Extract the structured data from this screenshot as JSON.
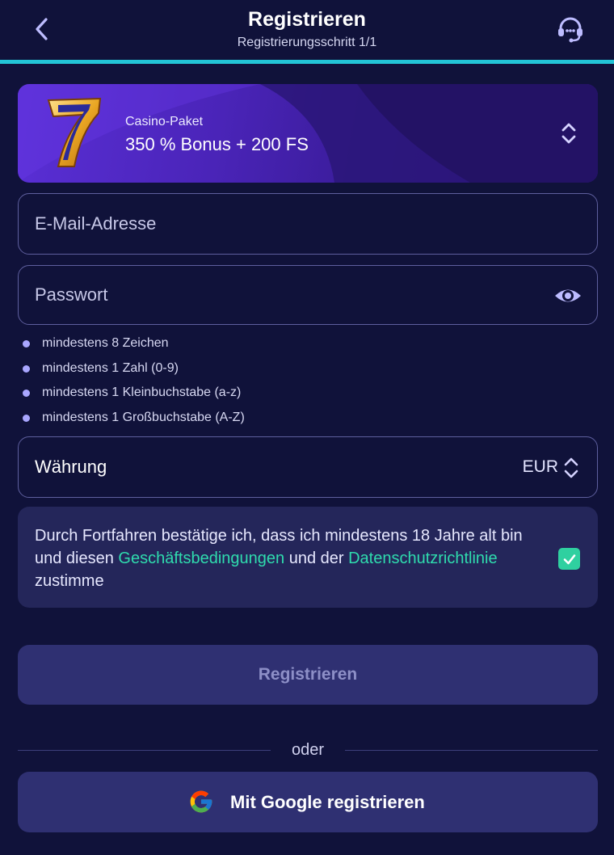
{
  "header": {
    "title": "Registrieren",
    "subtitle": "Registrierungsschritt 1/1",
    "progress_fraction": 1.0
  },
  "bonus": {
    "label": "Casino-Paket",
    "value": "350 % Bonus + 200 FS",
    "icon": "lucky-seven-icon"
  },
  "email": {
    "placeholder": "E-Mail-Adresse",
    "value": ""
  },
  "password": {
    "placeholder": "Passwort",
    "value": ""
  },
  "password_rules": [
    "mindestens 8 Zeichen",
    "mindestens 1 Zahl (0-9)",
    "mindestens 1 Kleinbuchstabe (a-z)",
    "mindestens 1 Großbuchstabe (A-Z)"
  ],
  "currency": {
    "label": "Währung",
    "value": "EUR"
  },
  "terms": {
    "text_before": "Durch Fortfahren bestätige ich, dass ich mindestens 18 Jahre alt bin und diesen ",
    "terms_link": "Geschäftsbedingungen",
    "text_middle": " und der ",
    "privacy_link": "Datenschutzrichtlinie",
    "text_after": " zustimme",
    "checked": true
  },
  "register_button": "Registrieren",
  "divider_text": "oder",
  "google_button": "Mit Google registrieren",
  "colors": {
    "background": "#10123a",
    "accent_cyan": "#23c4d6",
    "link_green": "#2fdcae",
    "bonus_purple": "#5a2fd6",
    "button_bg": "#2f3072"
  }
}
